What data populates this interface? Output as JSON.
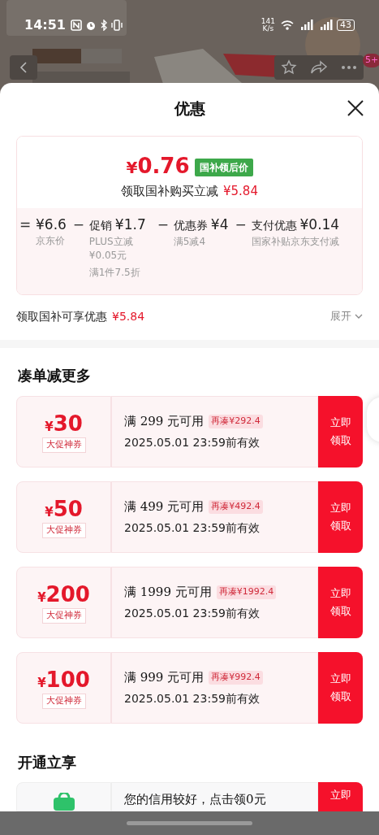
{
  "status_bar": {
    "time": "14:51",
    "speed": "141\nK/s",
    "battery": "43"
  },
  "background_page": {
    "badge": "5+"
  },
  "sheet": {
    "title": "优惠"
  },
  "price_card": {
    "price_currency": "¥",
    "price": "0.76",
    "price_tag": "国补领后价",
    "subtitle": "领取国补购买立减",
    "subtitle_amount": "¥5.84",
    "breakdown": [
      {
        "op": "=",
        "amount": "¥6.6",
        "notes": [
          "京东价"
        ]
      },
      {
        "op": "−",
        "label": "促销",
        "amount": "¥1.7",
        "notes": [
          "PLUS立减 ¥0.05元",
          "满1件7.5折"
        ]
      },
      {
        "op": "−",
        "label": "优惠券",
        "amount": "¥4",
        "notes": [
          "满5减4"
        ]
      },
      {
        "op": "−",
        "label": "支付优惠",
        "amount": "¥0.14",
        "notes": [
          "国家补贴京东支付减"
        ]
      }
    ]
  },
  "subsidy_row": {
    "label": "领取国补可享优惠",
    "amount": "¥5.84",
    "toggle": "展开",
    "expanded": false
  },
  "more_section": {
    "title": "凑单减更多",
    "coupons": [
      {
        "currency": "¥",
        "amount": "30",
        "tag": "大促神券",
        "condition": "满 299 元可用",
        "gap": "再凑¥292.4",
        "expiry": "2025.05.01 23:59前有效",
        "button": "立即领取"
      },
      {
        "currency": "¥",
        "amount": "50",
        "tag": "大促神券",
        "condition": "满 499 元可用",
        "gap": "再凑¥492.4",
        "expiry": "2025.05.01 23:59前有效",
        "button": "立即领取"
      },
      {
        "currency": "¥",
        "amount": "200",
        "tag": "大促神券",
        "condition": "满 1999 元可用",
        "gap": "再凑¥1992.4",
        "expiry": "2025.05.01 23:59前有效",
        "button": "立即领取"
      },
      {
        "currency": "¥",
        "amount": "100",
        "tag": "大促神券",
        "condition": "满 999 元可用",
        "gap": "再凑¥992.4",
        "expiry": "2025.05.01 23:59前有效",
        "button": "立即领取"
      }
    ]
  },
  "open_section": {
    "title": "开通立享",
    "offer": {
      "text": "您的信用较好，点击领0元",
      "button": "立即"
    }
  }
}
